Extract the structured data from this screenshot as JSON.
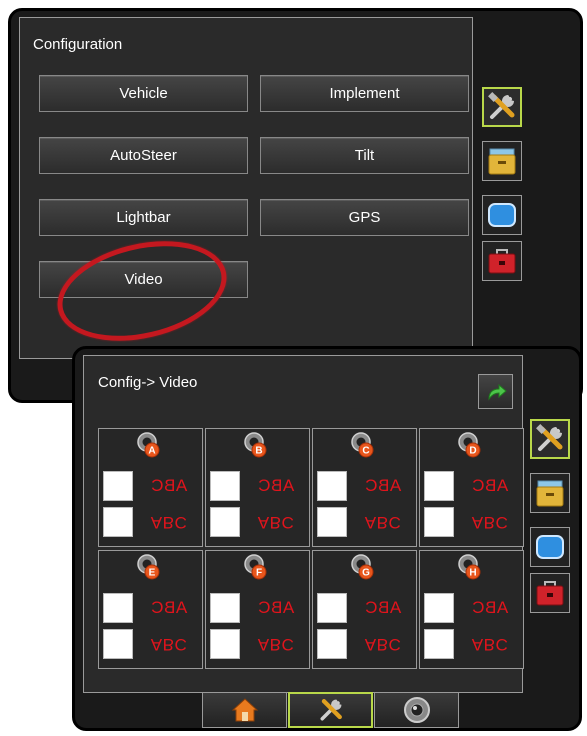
{
  "config_screen": {
    "title": "Configuration",
    "buttons": [
      "Vehicle",
      "Implement",
      "AutoSteer",
      "Tilt",
      "Lightbar",
      "GPS",
      "Video"
    ]
  },
  "video_screen": {
    "title": "Config-> Video",
    "cameras": [
      {
        "letter": "A",
        "mirror_text": "ABC",
        "flip_text": "ABC"
      },
      {
        "letter": "B",
        "mirror_text": "ABC",
        "flip_text": "ABC"
      },
      {
        "letter": "C",
        "mirror_text": "ABC",
        "flip_text": "ABC"
      },
      {
        "letter": "D",
        "mirror_text": "ABC",
        "flip_text": "ABC"
      },
      {
        "letter": "E",
        "mirror_text": "ABC",
        "flip_text": "ABC"
      },
      {
        "letter": "F",
        "mirror_text": "ABC",
        "flip_text": "ABC"
      },
      {
        "letter": "G",
        "mirror_text": "ABC",
        "flip_text": "ABC"
      },
      {
        "letter": "H",
        "mirror_text": "ABC",
        "flip_text": "ABC"
      }
    ]
  },
  "side_tabs": [
    "tools-icon",
    "file-cabinet-icon",
    "monitor-icon",
    "toolbox-icon"
  ],
  "bottom_tabs": [
    "home-icon",
    "tools-icon",
    "camera-icon"
  ],
  "colors": {
    "accent": "#b9d84a",
    "highlight": "#c4181f",
    "abc_text": "#e0141c"
  }
}
